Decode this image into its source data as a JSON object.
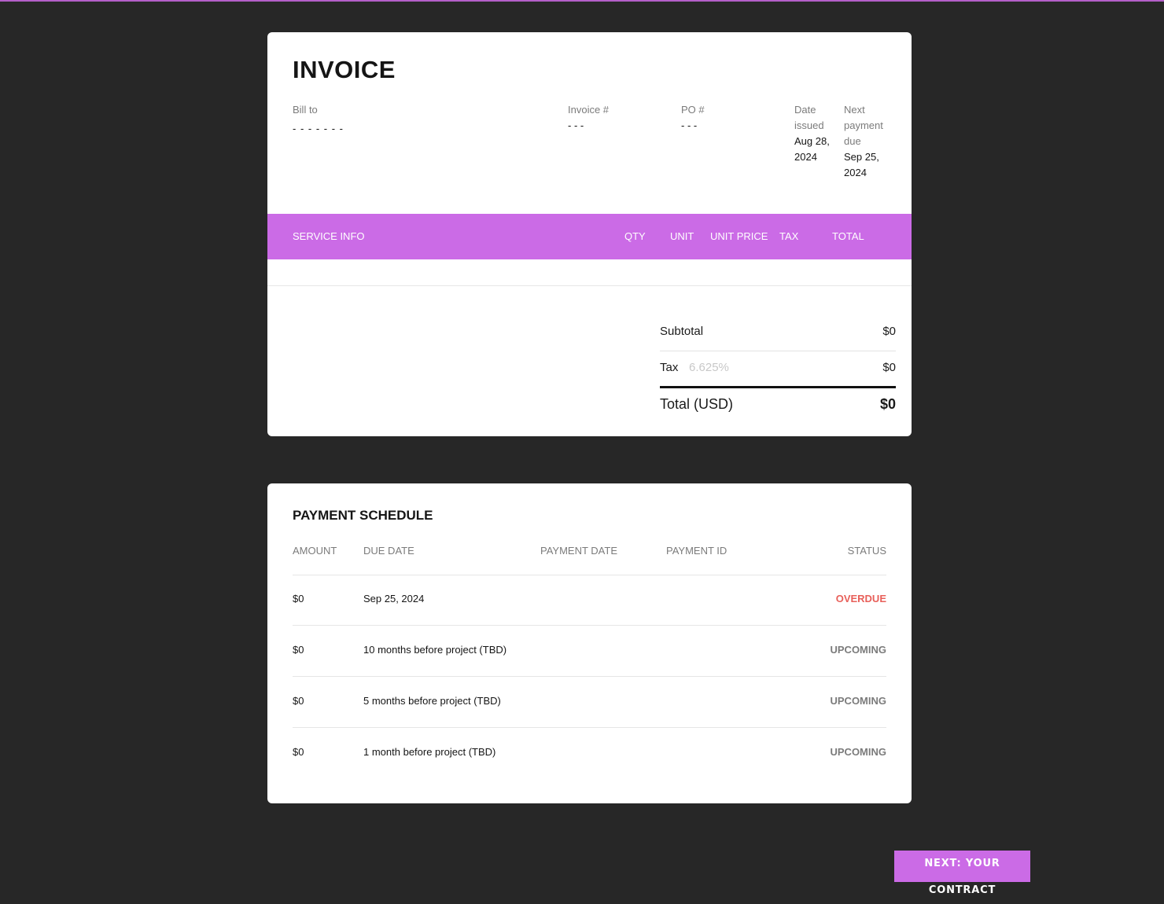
{
  "invoice": {
    "title": "INVOICE",
    "bill_to": {
      "label": "Bill to",
      "value": "- - - - - - -"
    },
    "invoice_number": {
      "label": "Invoice #",
      "value": "- - -"
    },
    "po_number": {
      "label": "PO #",
      "value": "- - -"
    },
    "date_issued": {
      "label": "Date issued",
      "value": "Aug 28, 2024"
    },
    "next_payment_due": {
      "label": "Next payment due",
      "value": "Sep 25, 2024"
    },
    "service_columns": {
      "service_info": "SERVICE INFO",
      "qty": "QTY",
      "unit": "UNIT",
      "unit_price": "UNIT PRICE",
      "tax": "TAX",
      "total": "TOTAL"
    },
    "totals": {
      "subtotal_label": "Subtotal",
      "subtotal_value": "$0",
      "tax_label": "Tax",
      "tax_rate": "6.625%",
      "tax_value": "$0",
      "total_label": "Total (USD)",
      "total_value": "$0"
    }
  },
  "payment_schedule": {
    "title": "PAYMENT SCHEDULE",
    "columns": {
      "amount": "AMOUNT",
      "due_date": "DUE DATE",
      "payment_date": "PAYMENT DATE",
      "payment_id": "PAYMENT ID",
      "status": "STATUS"
    },
    "rows": [
      {
        "amount": "$0",
        "due_date": "Sep 25, 2024",
        "payment_date": "",
        "payment_id": "",
        "status": "OVERDUE"
      },
      {
        "amount": "$0",
        "due_date": "10 months before project (TBD)",
        "payment_date": "",
        "payment_id": "",
        "status": "UPCOMING"
      },
      {
        "amount": "$0",
        "due_date": "5 months before project (TBD)",
        "payment_date": "",
        "payment_id": "",
        "status": "UPCOMING"
      },
      {
        "amount": "$0",
        "due_date": "1 month before project (TBD)",
        "payment_date": "",
        "payment_id": "",
        "status": "UPCOMING"
      }
    ]
  },
  "footer": {
    "next_button_label": "NEXT: YOUR CONTRACT"
  },
  "colors": {
    "accent": "#cb6be6",
    "overdue": "#e8605a",
    "upcoming": "#7b7b7b",
    "background": "#272727"
  }
}
